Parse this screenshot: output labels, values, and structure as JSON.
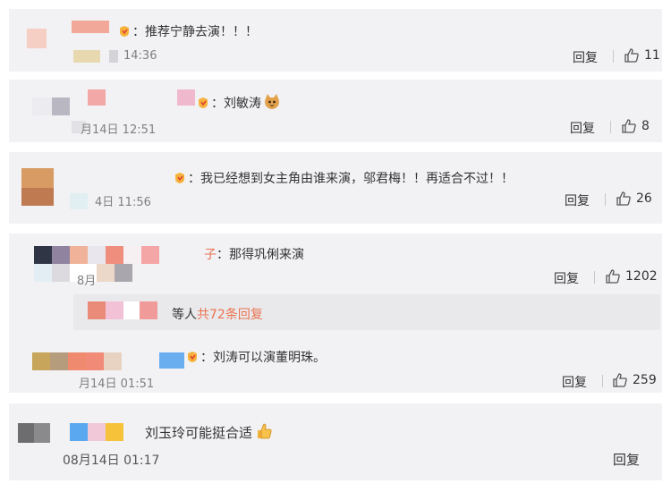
{
  "colors": {
    "card_bg": "#f2f2f5",
    "link": "#eb7350",
    "text": "#333333",
    "time": "#808080"
  },
  "comments": [
    {
      "text": "：推荐宁静去演！！！",
      "time": "14:36",
      "reply_label": "回复",
      "likes": "11"
    },
    {
      "text": "：刘敏涛",
      "emoji": "cat-face-emoji",
      "time": "月14日 12:51",
      "reply_label": "回复",
      "likes": "8"
    },
    {
      "text": "：我已经想到女主角由谁来演，邬君梅！！再适合不过！！",
      "time": "4日 11:56",
      "reply_label": "回复",
      "likes": "26"
    },
    {
      "text_prefix": "子",
      "text": "：那得巩俐来演",
      "time": "8月",
      "reply_label": "回复",
      "likes": "1202",
      "subreplies": {
        "label": "等人",
        "link": "共72条回复"
      },
      "nested": {
        "text": "：刘涛可以演董明珠。",
        "time": "月14日 01:51",
        "reply_label": "回复",
        "likes": "259"
      }
    },
    {
      "text": "刘玉玲可能挺合适",
      "emoji": "thumbs-up-emoji",
      "time": "08月14日 01:17",
      "reply_label": "回复"
    }
  ]
}
